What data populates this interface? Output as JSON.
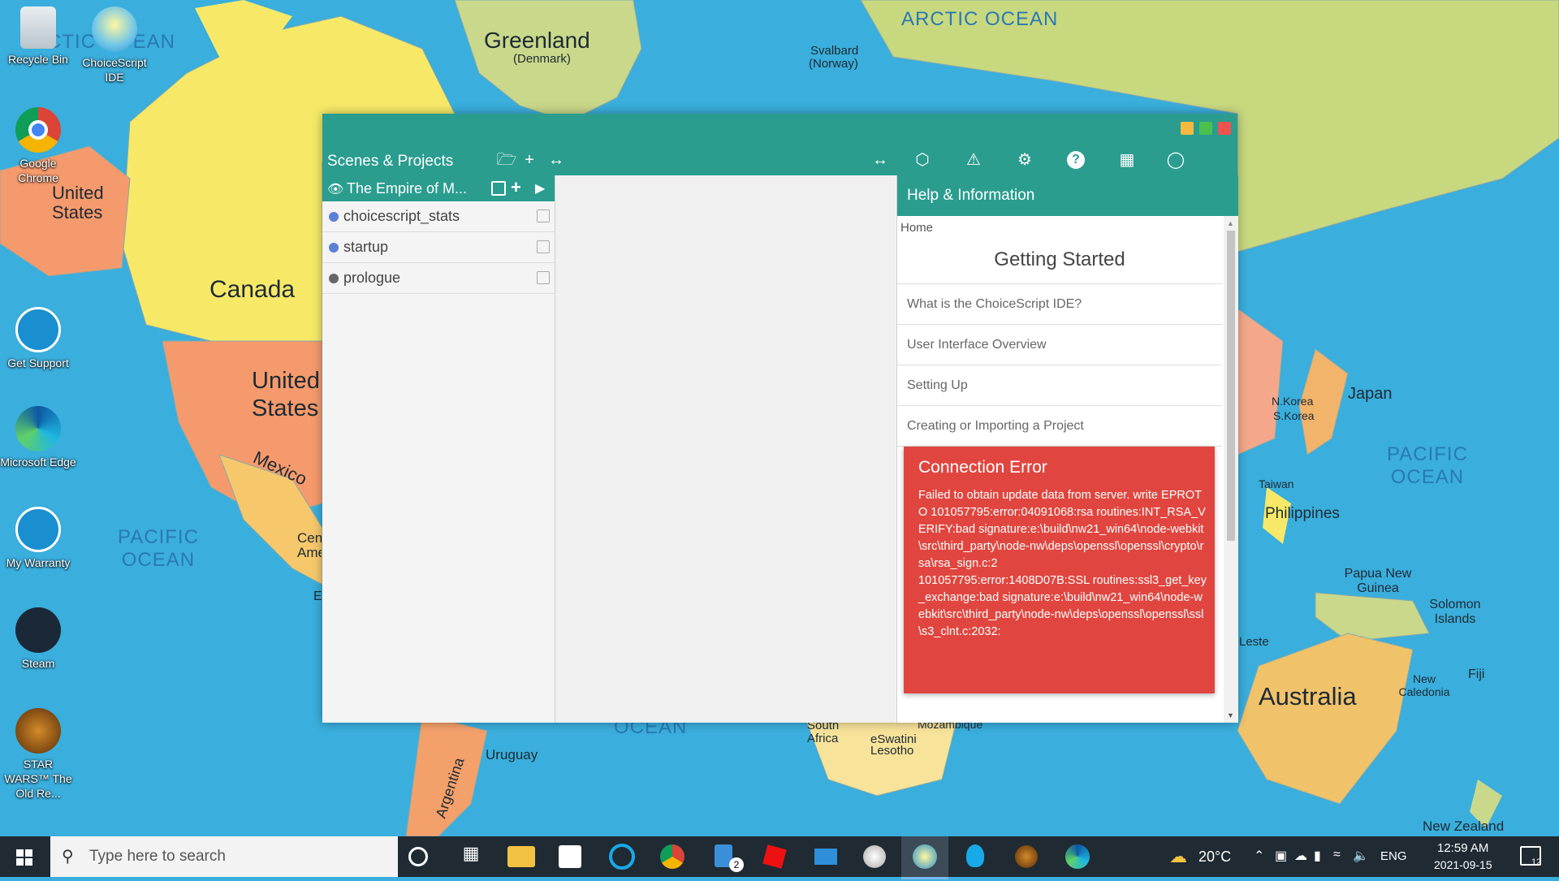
{
  "colors": {
    "teal": "#2a9d8f",
    "error_red": "#e0463f",
    "ocean": "#3aaedc",
    "taskbar": "#1f2a33"
  },
  "map": {
    "oceans": [
      {
        "id": "arctic",
        "text": "ARCTIC OCEAN"
      },
      {
        "id": "pacific-left",
        "text": "PACIFIC\nOCEAN"
      },
      {
        "id": "pacific-right",
        "text": "PACIFIC\nOCEAN"
      },
      {
        "id": "ocean-bottom",
        "text": "OCEAN"
      },
      {
        "id": "arctic-left",
        "text": "CTIC OCEAN"
      }
    ],
    "places": {
      "greenland": "Greenland",
      "denmark": "(Denmark)",
      "svalbard": "Svalbard",
      "norway": "(Norway)",
      "canada": "Canada",
      "united_states_1": "United States",
      "united_states_2": "United States",
      "mexico": "Mexico",
      "central_america": "Cen Ame",
      "japan": "Japan",
      "nkorea": "N.Korea",
      "skorea": "S.Korea",
      "taiwan": "Taiwan",
      "philippines": "Philippines",
      "papua": "Papua New Guinea",
      "solomon": "Solomon Islands",
      "australia": "Australia",
      "new_caledonia": "New Caledonia",
      "fiji": "Fiji",
      "new_zealand": "New Zealand",
      "uruguay": "Uruguay",
      "argentina": "Argentina",
      "south_africa": "South Africa",
      "eswatini": "eSwatini",
      "lesotho": "Lesotho",
      "mozambique": "Mozambique",
      "leste": "Leste",
      "e_letter": "E"
    }
  },
  "desktop_icons": [
    {
      "id": "recycle-bin",
      "label": "Recycle Bin"
    },
    {
      "id": "choicescript-ide",
      "label": "ChoiceScript IDE"
    },
    {
      "id": "google-chrome",
      "label": "Google Chrome"
    },
    {
      "id": "get-support",
      "label": "Get Support"
    },
    {
      "id": "microsoft-edge",
      "label": "Microsoft Edge"
    },
    {
      "id": "my-warranty",
      "label": "My Warranty"
    },
    {
      "id": "steam",
      "label": "Steam"
    },
    {
      "id": "star-wars",
      "label": "STAR WARS™ The Old Re..."
    }
  ],
  "ide": {
    "toolbar": {
      "title": "Scenes & Projects",
      "left_icons": [
        "folder-open-icon",
        "plus-icon",
        "expand-horizontal-icon"
      ],
      "right_icons": [
        "expand-horizontal-icon",
        "cube-icon",
        "warning-icon",
        "gear-icon",
        "help-icon",
        "book-icon",
        "lightbulb-icon"
      ]
    },
    "project": {
      "name": "The Empire of M..."
    },
    "scenes": [
      {
        "name": "choicescript_stats",
        "dot_color": "#5c7fd8"
      },
      {
        "name": "startup",
        "dot_color": "#5c7fd8"
      },
      {
        "name": "prologue",
        "dot_color": "#666666"
      }
    ],
    "help": {
      "header": "Help & Information",
      "home": "Home",
      "title": "Getting Started",
      "links": [
        "What is the ChoiceScript IDE?",
        "User Interface Overview",
        "Setting Up",
        "Creating or Importing a Project"
      ]
    },
    "error": {
      "title": "Connection Error",
      "message": "Failed to obtain update data from server. write EPROTO 101057795:error:04091068:rsa routines:INT_RSA_VERIFY:bad signature:e:\\build\\nw21_win64\\node-webkit\\src\\third_party\\node-nw\\deps\\openssl\\openssl\\crypto\\rsa\\rsa_sign.c:2\n101057795:error:1408D07B:SSL routines:ssl3_get_key_exchange:bad signature:e:\\build\\nw21_win64\\node-webkit\\src\\third_party\\node-nw\\deps\\openssl\\openssl\\ssl\\s3_clnt.c:2032:"
    }
  },
  "taskbar": {
    "search_placeholder": "Type here to search",
    "apps": [
      "cortana-icon",
      "task-view-icon",
      "file-explorer-icon",
      "store-icon",
      "cortana-ring-icon",
      "chrome-icon",
      "files-icon",
      "red-app-icon",
      "mail-icon",
      "paint-icon",
      "choicescript-icon",
      "bulb-icon",
      "swtor-icon",
      "edge-icon"
    ],
    "files_badge": "2",
    "weather": "20°C",
    "language": "ENG",
    "time": "12:59 AM",
    "date": "2021-09-15",
    "notifications": "12"
  }
}
